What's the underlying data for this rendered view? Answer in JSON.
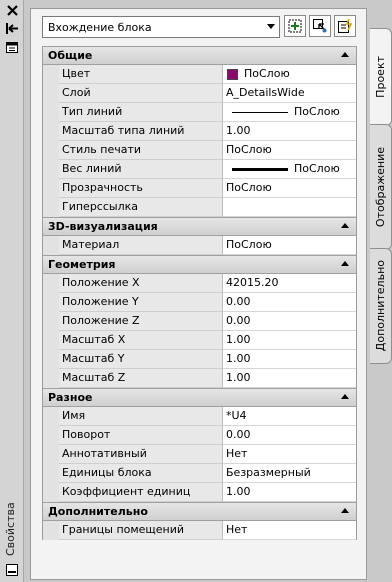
{
  "palette": {
    "title": "Свойства",
    "block_selector": "Вхождение блока",
    "toolbar_icons": [
      "quick-select-icon",
      "select-objects-icon",
      "toggle-pickadd-icon"
    ]
  },
  "side_tabs": [
    "Проект",
    "Отображение",
    "Дополнительно"
  ],
  "sections": [
    {
      "title": "Общие",
      "rows": [
        {
          "name": "Цвет",
          "value": "ПоСлою",
          "swatch": "#8a0a6e"
        },
        {
          "name": "Слой",
          "value": "A_DetailsWide"
        },
        {
          "name": "Тип линий",
          "value": "ПоСлою",
          "line": "thin"
        },
        {
          "name": "Масштаб типа линий",
          "value": "1.00"
        },
        {
          "name": "Стиль печати",
          "value": "ПоСлою"
        },
        {
          "name": "Вес линий",
          "value": "ПоСлою",
          "line": "thick"
        },
        {
          "name": "Прозрачность",
          "value": "ПоСлою"
        },
        {
          "name": "Гиперссылка",
          "value": ""
        }
      ]
    },
    {
      "title": "3D-визуализация",
      "rows": [
        {
          "name": "Материал",
          "value": "ПоСлою"
        }
      ]
    },
    {
      "title": "Геометрия",
      "rows": [
        {
          "name": "Положение X",
          "value": "42015.20"
        },
        {
          "name": "Положение Y",
          "value": "0.00"
        },
        {
          "name": "Положение Z",
          "value": "0.00"
        },
        {
          "name": "Масштаб X",
          "value": "1.00"
        },
        {
          "name": "Масштаб Y",
          "value": "1.00"
        },
        {
          "name": "Масштаб Z",
          "value": "1.00"
        }
      ]
    },
    {
      "title": "Разное",
      "rows": [
        {
          "name": "Имя",
          "value": "*U4"
        },
        {
          "name": "Поворот",
          "value": "0.00"
        },
        {
          "name": "Аннотативный",
          "value": "Нет"
        },
        {
          "name": "Единицы блока",
          "value": "Безразмерный"
        },
        {
          "name": "Коэффициент единиц",
          "value": "1.00"
        }
      ]
    },
    {
      "title": "Дополнительно",
      "rows": [
        {
          "name": "Границы помещений",
          "value": "Нет"
        }
      ]
    }
  ]
}
